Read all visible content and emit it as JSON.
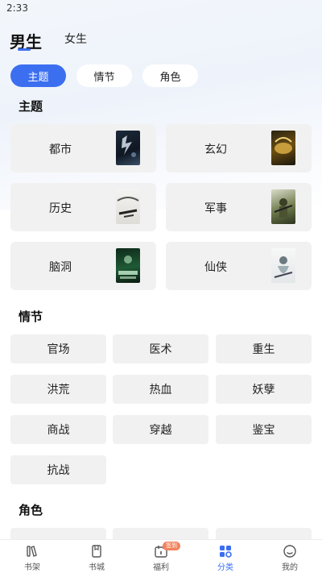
{
  "status_bar": {
    "time": "2:33"
  },
  "gender_tabs": {
    "active": "男生",
    "inactive": "女生",
    "accent_color": "#3d6ff0"
  },
  "category_pills": [
    {
      "label": "主题",
      "active": true
    },
    {
      "label": "情节",
      "active": false
    },
    {
      "label": "角色",
      "active": false
    }
  ],
  "sections": {
    "theme_title": "主题",
    "plot_title": "情节",
    "role_title": "角色"
  },
  "themes": [
    {
      "label": "都市",
      "cover_icon": "book-cover-dark"
    },
    {
      "label": "玄幻",
      "cover_icon": "book-cover-gold-dragon"
    },
    {
      "label": "历史",
      "cover_icon": "book-cover-ink"
    },
    {
      "label": "军事",
      "cover_icon": "book-cover-soldier"
    },
    {
      "label": "脑洞",
      "cover_icon": "book-cover-green-crowd"
    },
    {
      "label": "仙侠",
      "cover_icon": "book-cover-white-fairy"
    }
  ],
  "plots": [
    "官场",
    "医术",
    "重生",
    "洪荒",
    "热血",
    "妖孽",
    "商战",
    "穿越",
    "鉴宝",
    "抗战"
  ],
  "tabbar": [
    {
      "label": "书架",
      "icon": "bookshelf-icon",
      "active": false
    },
    {
      "label": "书城",
      "icon": "book-store-icon",
      "active": false
    },
    {
      "label": "福利",
      "icon": "calendar-gift-icon",
      "active": false,
      "badge": "签到"
    },
    {
      "label": "分类",
      "icon": "category-grid-icon",
      "active": true
    },
    {
      "label": "我的",
      "icon": "profile-icon",
      "active": false
    }
  ]
}
